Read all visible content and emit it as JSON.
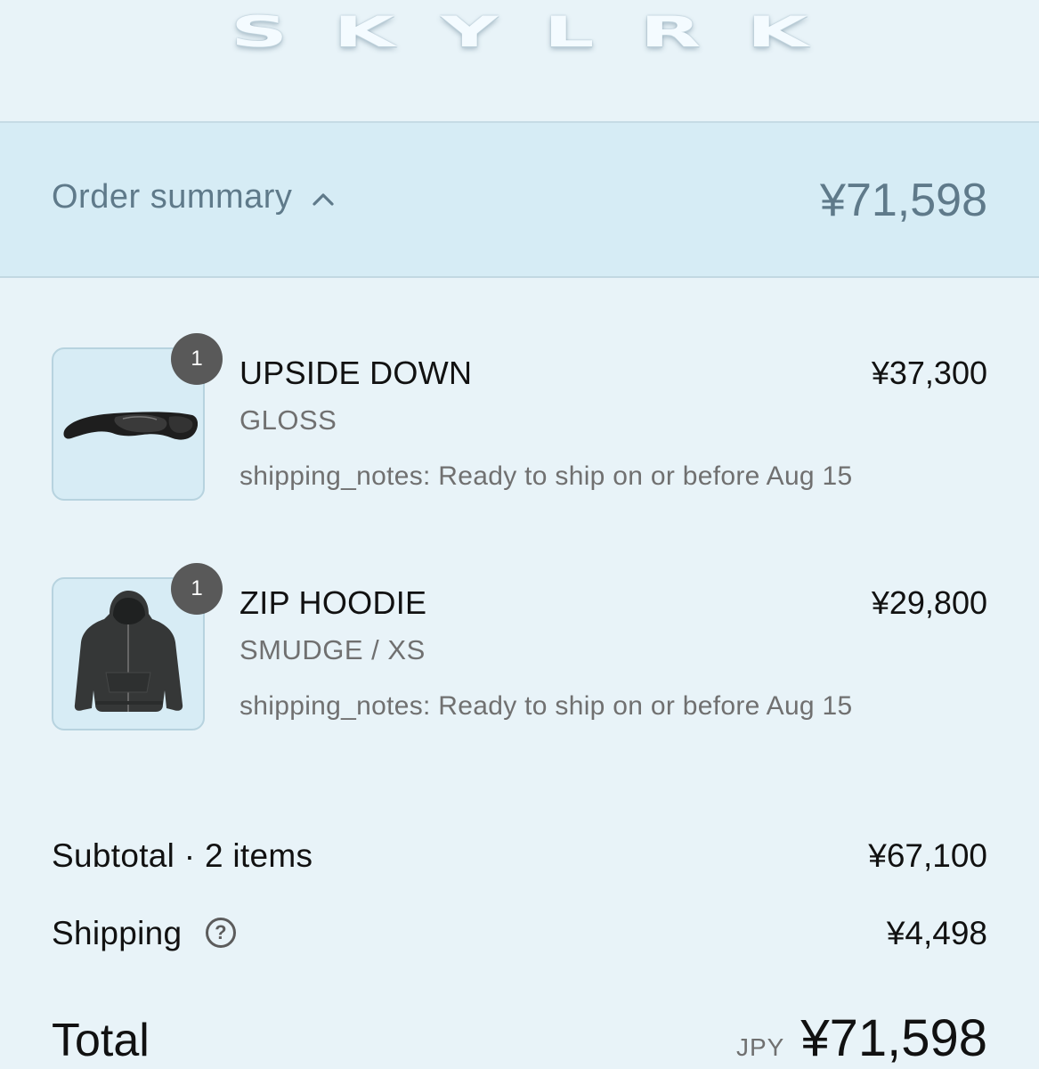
{
  "brand": {
    "logo_text": "SKYLRK"
  },
  "summary": {
    "label": "Order summary",
    "total": "¥71,598"
  },
  "items": [
    {
      "quantity": "1",
      "name": "UPSIDE DOWN",
      "variant": "GLOSS",
      "notes": "shipping_notes: Ready to ship on or before Aug 15",
      "price": "¥37,300",
      "image": "sunglasses"
    },
    {
      "quantity": "1",
      "name": "ZIP HOODIE",
      "variant": "SMUDGE / XS",
      "notes": "shipping_notes: Ready to ship on or before Aug 15",
      "price": "¥29,800",
      "image": "zip-hoodie"
    }
  ],
  "totals": {
    "subtotal_label": "Subtotal · 2 items",
    "subtotal_value": "¥67,100",
    "shipping_label": "Shipping",
    "shipping_value": "¥4,498",
    "shipping_help_icon": "question-circle-icon",
    "total_label": "Total",
    "currency": "JPY",
    "total_value": "¥71,598"
  }
}
